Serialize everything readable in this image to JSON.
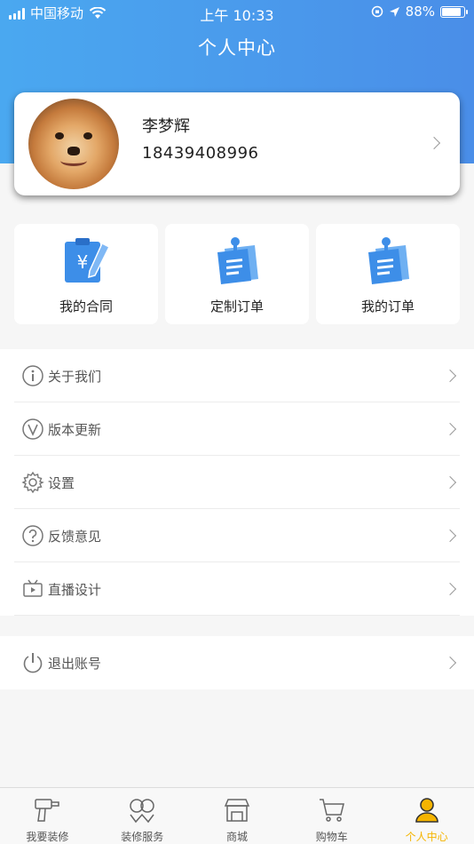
{
  "status_bar": {
    "carrier": "中国移动",
    "time": "上午 10:33",
    "battery": "88%",
    "battery_level": 0.88
  },
  "header": {
    "title": "个人中心"
  },
  "profile": {
    "name": "李梦辉",
    "phone": "18439408996"
  },
  "quick_actions": [
    {
      "label": "我的合同",
      "icon": "contract-yen-icon"
    },
    {
      "label": "定制订单",
      "icon": "custom-order-icon"
    },
    {
      "label": "我的订单",
      "icon": "my-order-icon"
    }
  ],
  "menu": [
    {
      "label": "关于我们",
      "icon": "info-icon"
    },
    {
      "label": "版本更新",
      "icon": "version-icon"
    },
    {
      "label": "设置",
      "icon": "gear-icon"
    },
    {
      "label": "反馈意见",
      "icon": "question-icon"
    },
    {
      "label": "直播设计",
      "icon": "live-video-icon"
    }
  ],
  "logout": {
    "label": "退出账号",
    "icon": "power-icon"
  },
  "tabbar": [
    {
      "label": "我要装修",
      "icon": "drill-icon"
    },
    {
      "label": "装修服务",
      "icon": "service-icon"
    },
    {
      "label": "商城",
      "icon": "shop-icon"
    },
    {
      "label": "购物车",
      "icon": "cart-icon"
    },
    {
      "label": "个人中心",
      "icon": "person-icon",
      "active": true
    }
  ],
  "colors": {
    "header_gradient_start": "#4aa8f0",
    "header_gradient_end": "#4a8ee8",
    "active_tab": "#f5b400",
    "icon_blue": "#3d8ee8"
  }
}
